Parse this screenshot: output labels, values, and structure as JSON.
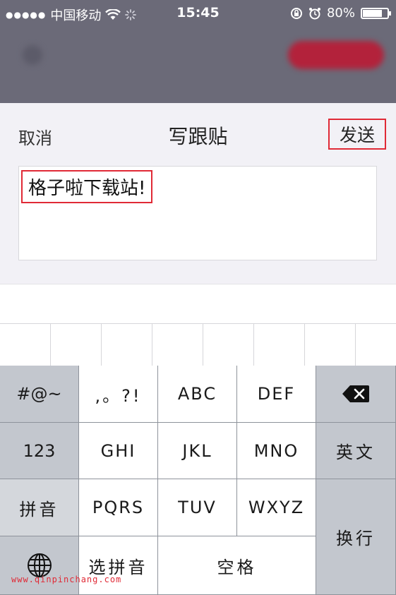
{
  "status_bar": {
    "signal_dots": "●●●●●",
    "carrier": "中国移动",
    "time": "15:45",
    "battery_percent": "80%",
    "battery_level": 0.8,
    "icons": [
      "signal-icon",
      "wifi-icon",
      "loading-icon",
      "rotation-lock-icon",
      "alarm-icon",
      "battery-icon"
    ]
  },
  "compose": {
    "cancel_label": "取消",
    "title": "写跟贴",
    "send_label": "发送",
    "text_value": "格子啦下载站!"
  },
  "keyboard": {
    "rows": [
      [
        "#@~",
        ",。?!",
        "ABC",
        "DEF",
        "backspace"
      ],
      [
        "123",
        "GHI",
        "JKL",
        "MNO",
        "英文"
      ],
      [
        "拼音",
        "PQRS",
        "TUV",
        "WXYZ",
        "换行"
      ],
      [
        "globe",
        "选拼音",
        "空格"
      ]
    ],
    "symbols_label": "#@~",
    "punct_label": ",。?!",
    "abc_label": "ABC",
    "def_label": "DEF",
    "num_label": "123",
    "ghi_label": "GHI",
    "jkl_label": "JKL",
    "mno_label": "MNO",
    "english_label": "英文",
    "pinyin_label": "拼音",
    "pqrs_label": "PQRS",
    "tuv_label": "TUV",
    "wxyz_label": "WXYZ",
    "newline_label": "换行",
    "select_pinyin_label": "选拼音",
    "space_label": "空格"
  },
  "watermark": "www.qinpinchang.com",
  "colors": {
    "highlight_red": "#e02a36",
    "nav_bg": "#6b6a78",
    "sheet_bg": "#f2f1f6",
    "keyboard_gray": "#b9bdc4"
  }
}
